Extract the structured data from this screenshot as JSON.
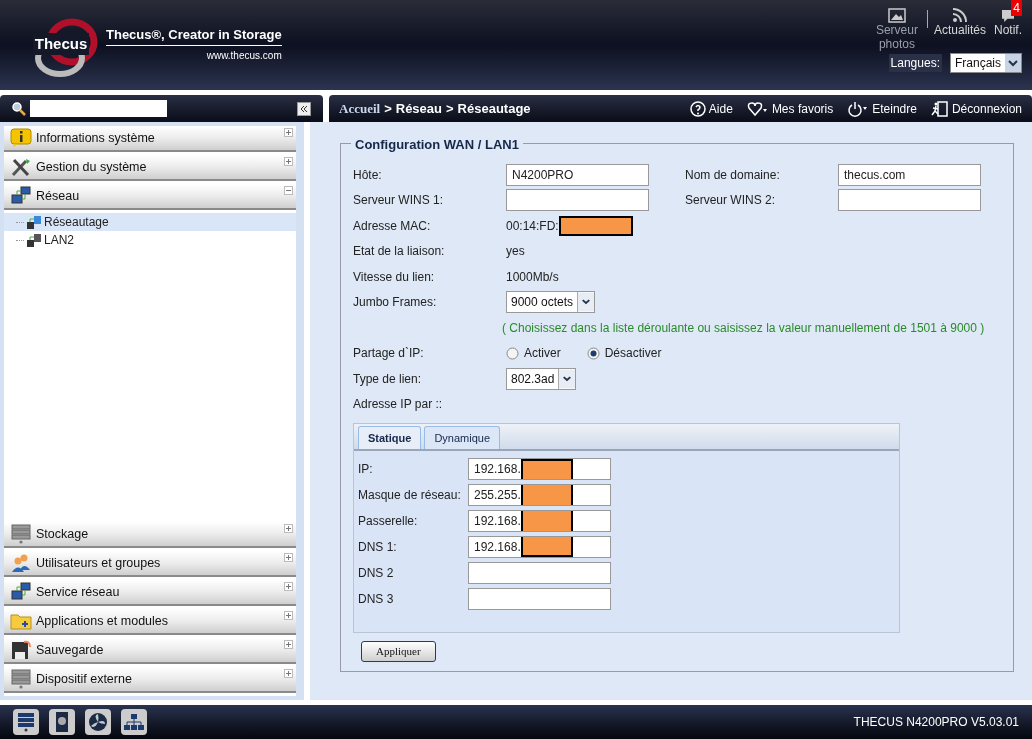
{
  "header": {
    "logo": {
      "brand": "Thecus",
      "tagline": "Thecus®, Creator in Storage",
      "url": "www.thecus.com"
    },
    "top_icons": [
      {
        "label": "Serveur photos"
      },
      {
        "label": "Actualités"
      },
      {
        "label": "Notif.",
        "badge": "4"
      }
    ],
    "language": {
      "label": "Langues:",
      "value": "Français"
    }
  },
  "sidebar": {
    "items": [
      {
        "label": "Informations système",
        "expanded": false
      },
      {
        "label": "Gestion du système",
        "expanded": false
      },
      {
        "label": "Réseau",
        "expanded": true,
        "children": [
          {
            "label": "Réseautage",
            "selected": true
          },
          {
            "label": "LAN2",
            "selected": false
          }
        ]
      },
      {
        "label": "Stockage",
        "expanded": false
      },
      {
        "label": "Utilisateurs et groupes",
        "expanded": false
      },
      {
        "label": "Service réseau",
        "expanded": false
      },
      {
        "label": "Applications et modules",
        "expanded": false
      },
      {
        "label": "Sauvegarde",
        "expanded": false
      },
      {
        "label": "Dispositif externe",
        "expanded": false
      }
    ]
  },
  "toolbar": {
    "breadcrumb": [
      "Accueil",
      "Réseau",
      "Réseautage"
    ],
    "separator": ">",
    "actions": [
      {
        "label": "Aide"
      },
      {
        "label": "Mes favoris"
      },
      {
        "label": "Eteindre"
      },
      {
        "label": "Déconnexion"
      }
    ]
  },
  "form": {
    "title": "Configuration WAN / LAN1",
    "rows": [
      {
        "fields": [
          {
            "kind": "input",
            "label": "Hôte:",
            "value": "N4200PRO"
          },
          {
            "kind": "input",
            "label": "Nom de domaine:",
            "value": "thecus.com"
          }
        ]
      },
      {
        "fields": [
          {
            "kind": "input",
            "label": "Serveur WINS 1:"
          },
          {
            "kind": "input",
            "label": "Serveur WINS 2:"
          }
        ]
      },
      {
        "fields": [
          {
            "kind": "static",
            "label": "Adresse MAC:",
            "value": "00:14:FD:",
            "redacted": true
          }
        ]
      },
      {
        "fields": [
          {
            "kind": "static",
            "label": "Etat de la liaison:",
            "value": "yes"
          }
        ]
      },
      {
        "fields": [
          {
            "kind": "static",
            "label": "Vitesse du lien:",
            "value": "1000Mb/s"
          }
        ]
      },
      {
        "fields": [
          {
            "kind": "select",
            "label": "Jumbo Frames:",
            "value": "9000 octets"
          }
        ]
      },
      {
        "fields": [
          {
            "kind": "hint",
            "text": "( Choisissez dans la liste déroulante ou saisissez la valeur manuellement de 1501 à 9000 )"
          }
        ]
      },
      {
        "fields": [
          {
            "kind": "radio",
            "label": "Partage d`IP:",
            "options": [
              {
                "label": "Activer",
                "selected": false
              },
              {
                "label": "Désactiver",
                "selected": true
              }
            ]
          }
        ]
      },
      {
        "fields": [
          {
            "kind": "select",
            "label": "Type de lien:",
            "value": "802.3ad"
          }
        ]
      },
      {
        "fields": [
          {
            "kind": "label",
            "label": "Adresse IP par ::"
          }
        ]
      }
    ],
    "tabs": [
      {
        "label": "Statique",
        "selected": true
      },
      {
        "label": "Dynamique",
        "selected": false
      }
    ],
    "ip_fields": [
      {
        "label": "IP:",
        "value": "192.168.",
        "redacted": true
      },
      {
        "label": "Masque de réseau:",
        "value": "255.255.",
        "redacted": true
      },
      {
        "label": "Passerelle:",
        "value": "192.168.",
        "redacted": true
      },
      {
        "label": "DNS 1:",
        "value": "192.168.",
        "redacted": true
      },
      {
        "label": "DNS 2"
      },
      {
        "label": "DNS 3"
      }
    ],
    "apply_button": "Appliquer"
  },
  "status_bar": {
    "version": "THECUS N4200PRO V5.03.01"
  }
}
